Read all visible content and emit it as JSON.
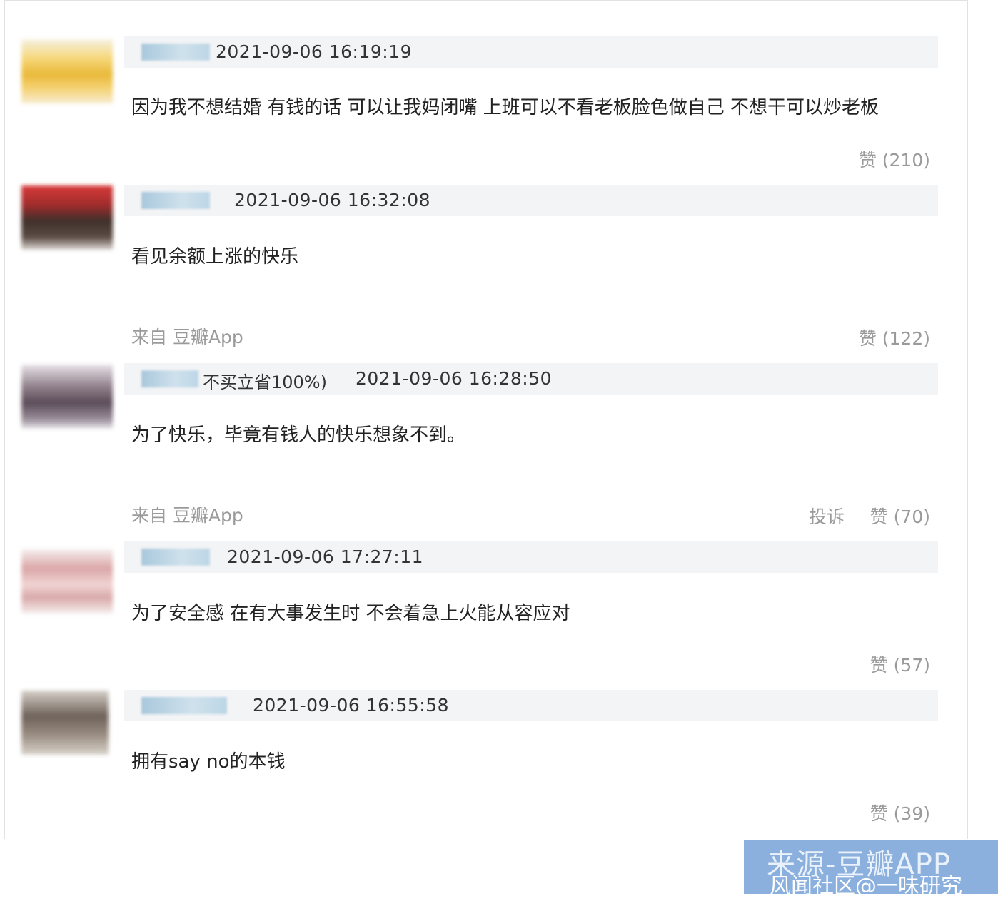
{
  "comments": [
    {
      "timestamp": "2021-09-06 16:19:19",
      "username_extra": "",
      "text": "因为我不想结婚 有钱的话 可以让我妈闭嘴 上班可以不看老板脸色做自己 不想干可以炒老板",
      "source": "",
      "report": "",
      "likes": "赞 (210)"
    },
    {
      "timestamp": "2021-09-06 16:32:08",
      "username_extra": "",
      "text": "看见余额上涨的快乐",
      "source": "来自 豆瓣App",
      "report": "",
      "likes": "赞 (122)"
    },
    {
      "timestamp": "2021-09-06 16:28:50",
      "username_extra": "不买立省100%)",
      "text": "为了快乐，毕竟有钱人的快乐想象不到。",
      "source": "来自 豆瓣App",
      "report": "投诉",
      "likes": "赞 (70)"
    },
    {
      "timestamp": "2021-09-06 17:27:11",
      "username_extra": "",
      "text": "为了安全感 在有大事发生时 不会着急上火能从容应对",
      "source": "",
      "report": "",
      "likes": "赞 (57)"
    },
    {
      "timestamp": "2021-09-06 16:55:58",
      "username_extra": "",
      "text": "拥有say no的本钱",
      "source": "",
      "report": "",
      "likes": "赞 (39)"
    }
  ],
  "watermark": {
    "line1": "来源-豆瓣APP",
    "line2": "风闻社区@一味研究"
  }
}
